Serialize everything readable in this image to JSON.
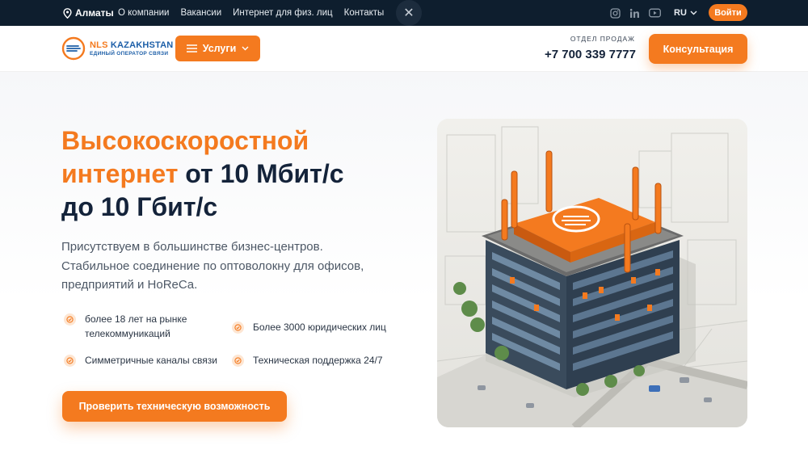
{
  "topbar": {
    "city": "Алматы",
    "nav": [
      "О компании",
      "Вакансии",
      "Интернет для физ. лиц",
      "Контакты"
    ],
    "social_icons": [
      "instagram-icon",
      "linkedin-icon",
      "youtube-icon"
    ],
    "lang": "RU",
    "login_label": "Войти"
  },
  "header": {
    "logo_name_a": "NLS",
    "logo_name_b": " KAZAKHSTAN",
    "logo_tag": "ЕДИНЫЙ ОПЕРАТОР СВЯЗИ",
    "services_label": "Услуги",
    "sales_label": "ОТДЕЛ ПРОДАЖ",
    "phone": "+7 700 339 7777",
    "consult_label": "Консультация"
  },
  "hero": {
    "title_orange_1": "Высокоскоростной",
    "title_orange_2": "интернет",
    "title_dark_1": " от 10 Мбит/с",
    "title_dark_2": "до 10 Гбит/с",
    "lead_1": "Присутствуем в большинстве бизнес-центров.",
    "lead_2": "Стабильное соединение по оптоволокну для офисов,",
    "lead_3": "предприятий и HoReCa.",
    "features": [
      {
        "line1": "более 18 лет на рынке",
        "line2": "телекоммуникаций"
      },
      {
        "line1": "Более 3000 юридических лиц",
        "line2": ""
      },
      {
        "line1": "Симметричные каналы связи",
        "line2": ""
      },
      {
        "line1": "Техническая поддержка 24/7",
        "line2": ""
      }
    ],
    "cta_label": "Проверить техническую возможность"
  },
  "colors": {
    "accent": "#f47a1f",
    "topbar_bg": "#0e1e2e",
    "text_dark": "#14233a",
    "logo_blue": "#1d5fa8"
  }
}
